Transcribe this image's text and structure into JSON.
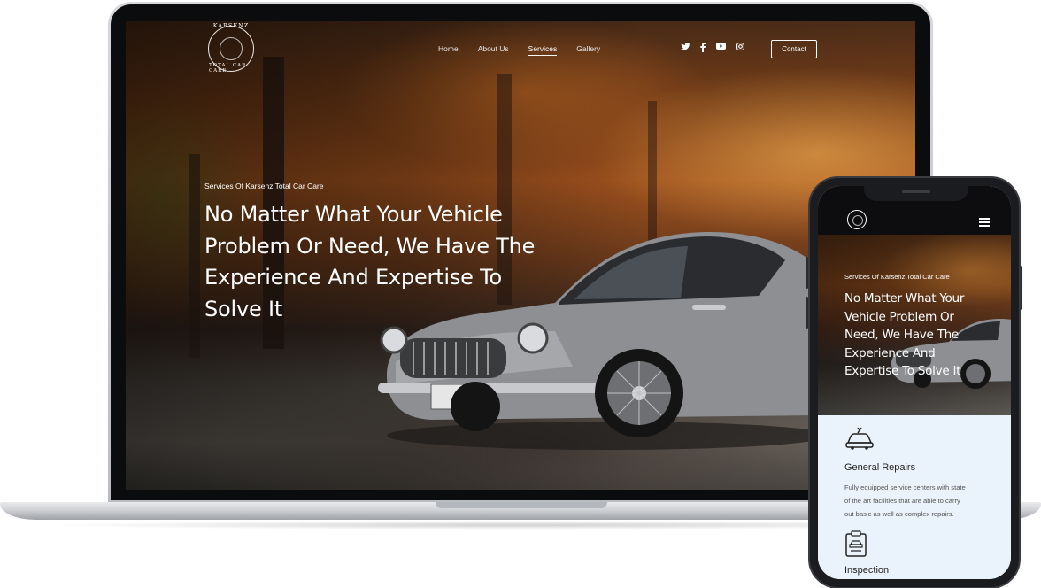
{
  "laptop": {
    "nav": {
      "logo": {
        "text_top": "KARSENZ",
        "text_bottom": "TOTAL CAR CARE"
      },
      "links": [
        {
          "label": "Home",
          "active": false
        },
        {
          "label": "About Us",
          "active": false
        },
        {
          "label": "Services",
          "active": true
        },
        {
          "label": "Gallery",
          "active": false
        }
      ],
      "social_icons": [
        "twitter-icon",
        "facebook-icon",
        "youtube-icon",
        "instagram-icon"
      ],
      "contact_label": "Contact"
    },
    "hero": {
      "subtitle": "Services Of Karsenz Total Car Care",
      "title_lines": [
        "No Matter What Your Vehicle",
        "Problem Or Need, We Have The",
        "Experience And Expertise To",
        "Solve It"
      ]
    }
  },
  "phone": {
    "hero": {
      "subtitle": "Services Of Karsenz Total Car Care",
      "title_lines": [
        "No Matter What Your",
        "Vehicle Problem Or",
        "Need, We Have The",
        "Experience And",
        "Expertise To Solve It"
      ]
    },
    "services": [
      {
        "icon": "car-wrench-icon",
        "title": "General Repairs",
        "text_lines": [
          "Fully equipped service centers with state",
          "of the art facilities that are able to carry",
          "out basic as well as complex repairs."
        ]
      },
      {
        "icon": "clipboard-car-icon",
        "title": "Inspection"
      }
    ]
  }
}
